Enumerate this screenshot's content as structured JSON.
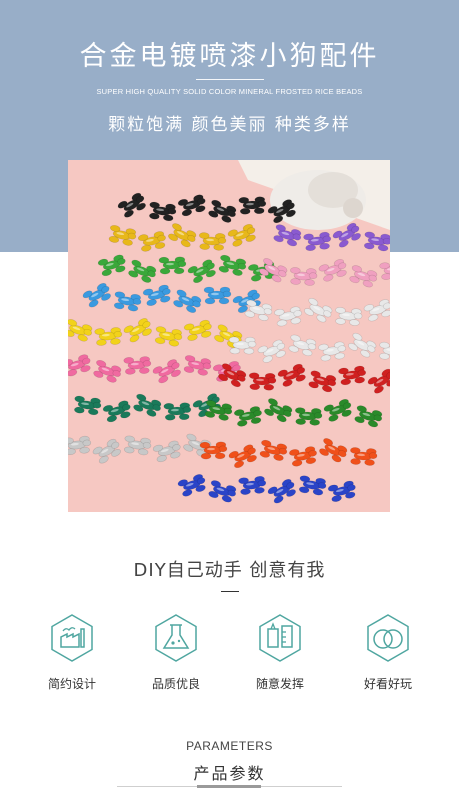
{
  "header": {
    "title": "合金电镀喷漆小狗配件",
    "subtitle_en": "SUPER HIGH QUALITY SOLID COLOR MINERAL FROSTED RICE BEADS",
    "tagline": "颗粒饱满 颜色美丽 种类多样"
  },
  "photo": {
    "background_color": "#f6c8c2",
    "charm_colors": [
      "#222222",
      "#e8b81a",
      "#3aa83a",
      "#3a9ae0",
      "#f2d21a",
      "#f06aa0",
      "#1a7a5a",
      "#c8c8c8",
      "#2a44c8",
      "#8a5ad0",
      "#e8e8e8",
      "#d02020",
      "#2a8a2a",
      "#f0501a"
    ]
  },
  "diy": {
    "heading": "DIY自己动手 创意有我"
  },
  "features": [
    {
      "icon": "factory-icon",
      "label": "简约设计"
    },
    {
      "icon": "flask-icon",
      "label": "品质优良"
    },
    {
      "icon": "tools-icon",
      "label": "随意发挥"
    },
    {
      "icon": "rings-icon",
      "label": "好看好玩"
    }
  ],
  "parameters": {
    "heading_en": "PARAMETERS",
    "heading_cn": "产品参数"
  },
  "colors": {
    "banner": "#98aec8",
    "icon_teal": "#4fa6a0"
  }
}
